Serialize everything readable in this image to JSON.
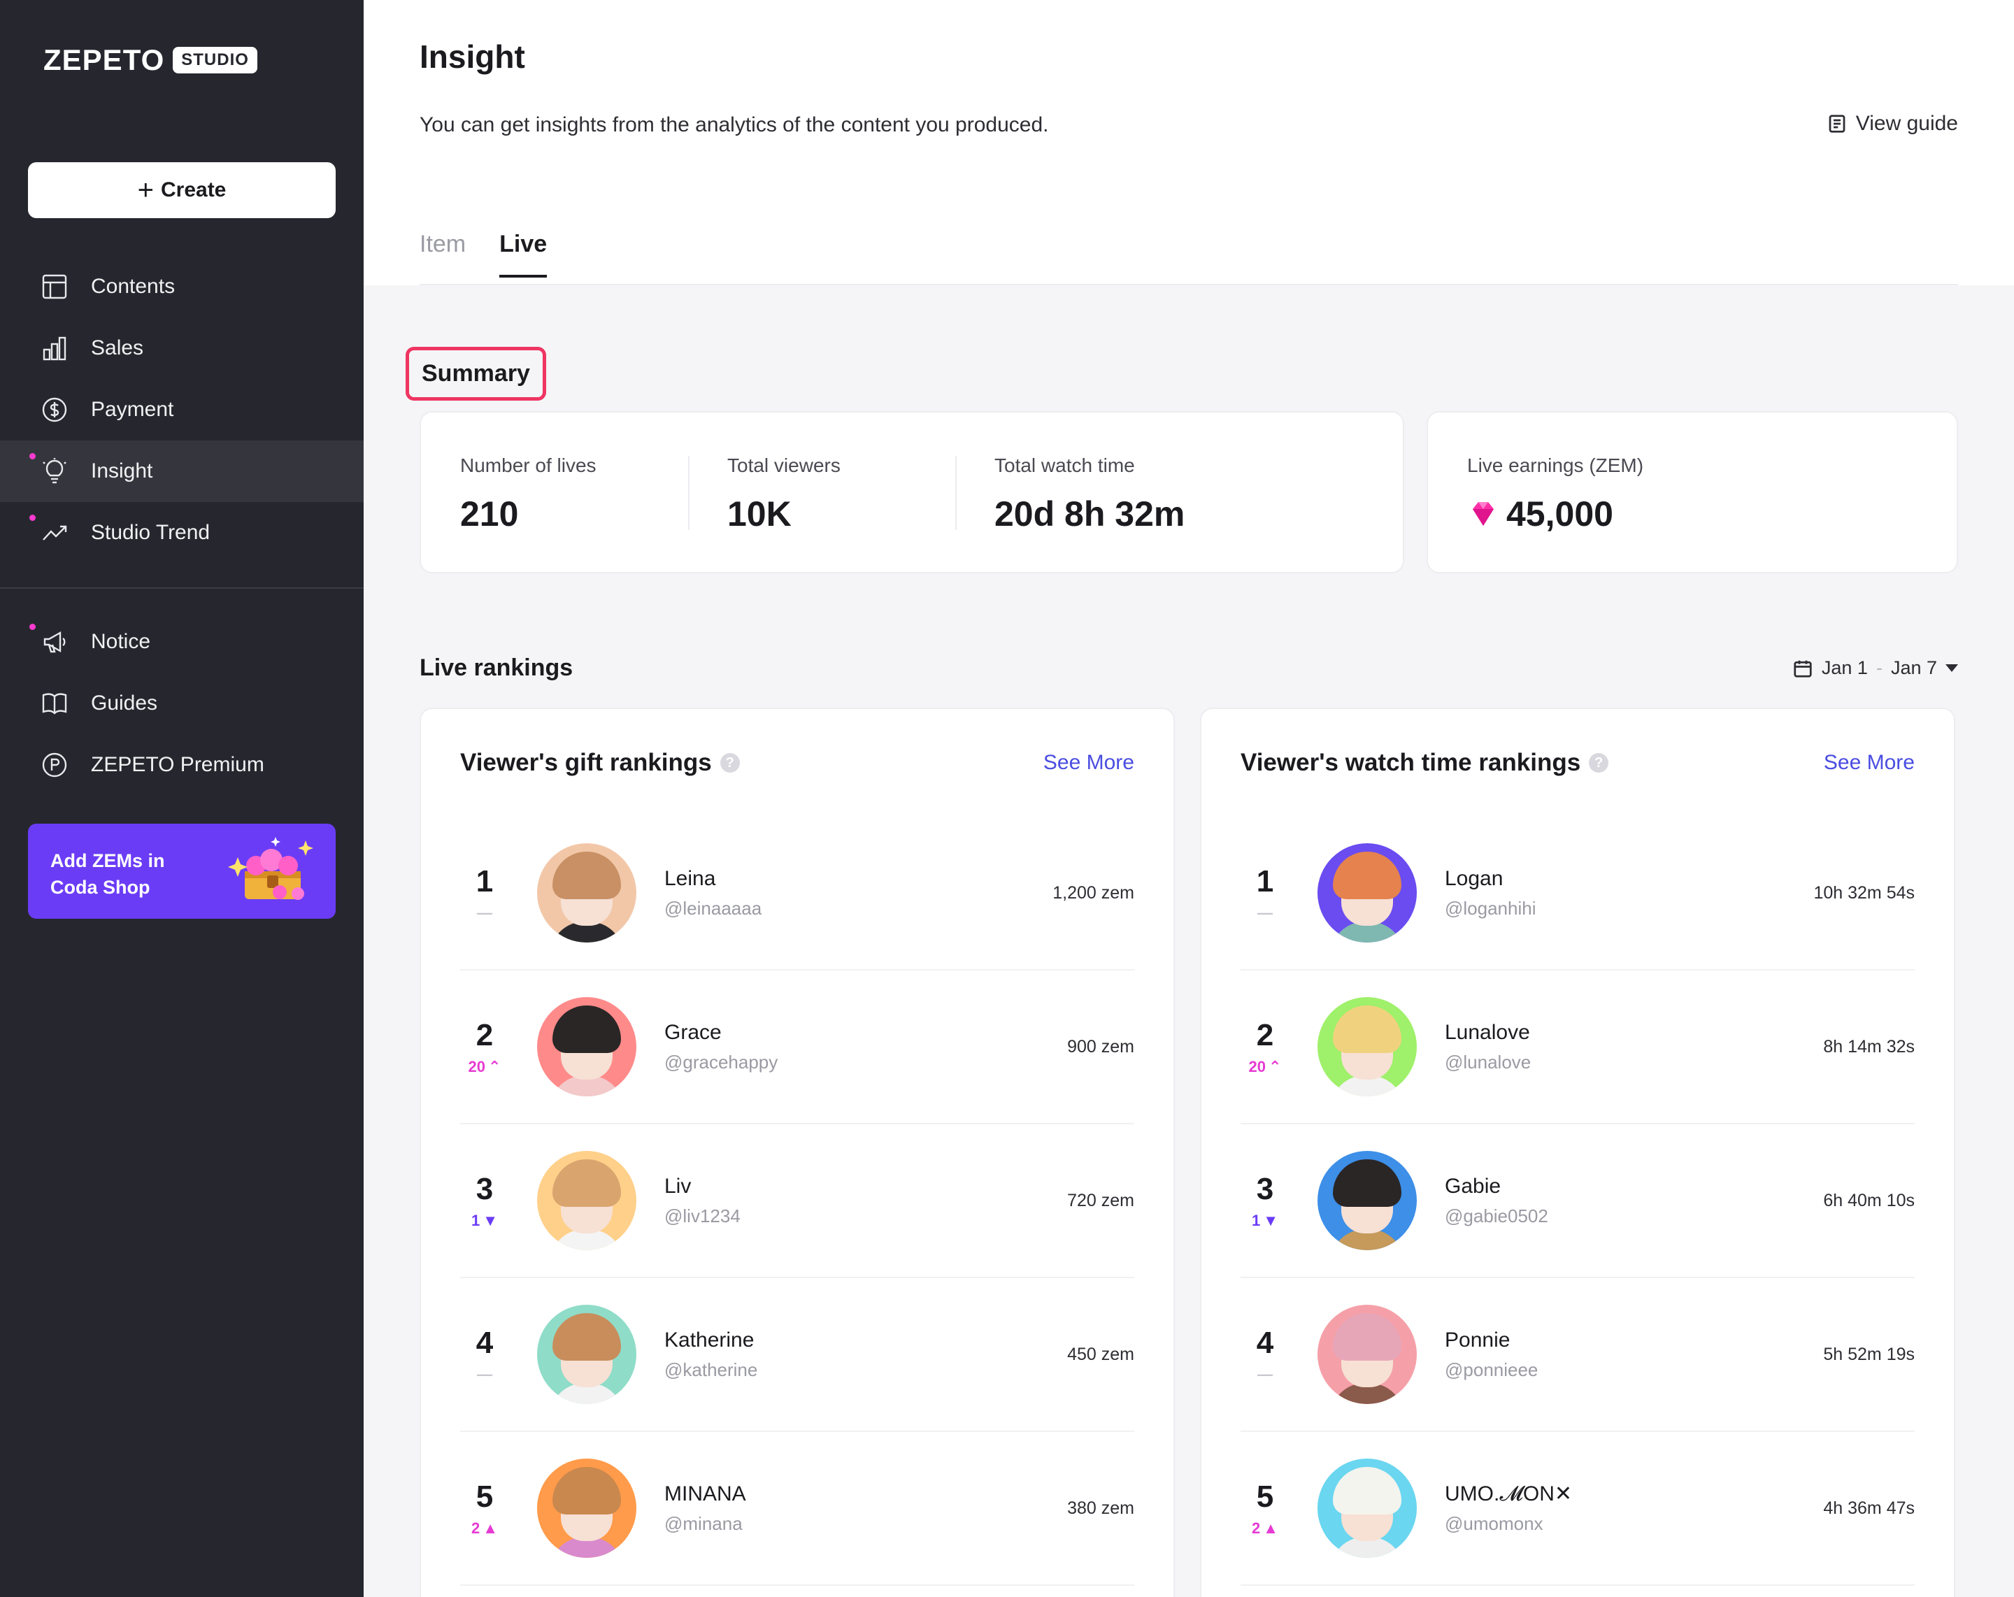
{
  "sidebar": {
    "logo": "ZEPETO",
    "logo_badge": "STUDIO",
    "create_label": "Create",
    "nav": [
      {
        "label": "Contents",
        "icon": "layout-icon",
        "dot": false,
        "active": false
      },
      {
        "label": "Sales",
        "icon": "bar-chart-icon",
        "dot": false,
        "active": false
      },
      {
        "label": "Payment",
        "icon": "dollar-coin-icon",
        "dot": false,
        "active": false
      },
      {
        "label": "Insight",
        "icon": "lightbulb-icon",
        "dot": true,
        "active": true
      },
      {
        "label": "Studio Trend",
        "icon": "trend-up-icon",
        "dot": true,
        "active": false
      }
    ],
    "nav2": [
      {
        "label": "Notice",
        "icon": "megaphone-icon",
        "dot": true
      },
      {
        "label": "Guides",
        "icon": "book-icon",
        "dot": false
      },
      {
        "label": "ZEPETO Premium",
        "icon": "premium-p-icon",
        "dot": false
      }
    ],
    "promo": {
      "line1": "Add ZEMs in",
      "line2": "Coda Shop"
    }
  },
  "header": {
    "title": "Insight",
    "description": "You can get insights from the analytics of the content you produced.",
    "view_guide": "View guide",
    "tabs": [
      {
        "label": "Item",
        "active": false
      },
      {
        "label": "Live",
        "active": true
      }
    ]
  },
  "summary": {
    "title": "Summary",
    "stats": [
      {
        "label": "Number of lives",
        "value": "210"
      },
      {
        "label": "Total viewers",
        "value": "10K"
      },
      {
        "label": "Total watch time",
        "value": "20d 8h 32m"
      }
    ],
    "earnings": {
      "label": "Live earnings (ZEM)",
      "value": "45,000"
    }
  },
  "rankings": {
    "title": "Live rankings",
    "date_start": "Jan 1",
    "date_sep": "-",
    "date_end": "Jan 7",
    "gift": {
      "title": "Viewer's gift rankings",
      "see_more": "See More",
      "rows": [
        {
          "rank": "1",
          "change": "—",
          "dir": "none",
          "name": "Leina",
          "handle": "@leinaaaaa",
          "value": "1,200 zem",
          "bg": "#f2c7a8",
          "hair": "#c89064",
          "body": "#2a2a2e"
        },
        {
          "rank": "2",
          "change": "20",
          "dir": "up",
          "name": "Grace",
          "handle": "@gracehappy",
          "value": "900 zem",
          "bg": "#ff8a8a",
          "hair": "#2a2626",
          "body": "#f3c9c9"
        },
        {
          "rank": "3",
          "change": "1",
          "dir": "down",
          "name": "Liv",
          "handle": "@liv1234",
          "value": "720 zem",
          "bg": "#ffd08a",
          "hair": "#d9a46e",
          "body": "#f4f4f4"
        },
        {
          "rank": "4",
          "change": "—",
          "dir": "none",
          "name": "Katherine",
          "handle": "@katherine",
          "value": "450 zem",
          "bg": "#8fdcc8",
          "hair": "#c98d5c",
          "body": "#f2f2f2"
        },
        {
          "rank": "5",
          "change": "2",
          "dir": "up",
          "name": "MINANA",
          "handle": "@minana",
          "value": "380 zem",
          "bg": "#ff9b4a",
          "hair": "#c9884e",
          "body": "#d98acd"
        }
      ]
    },
    "watch": {
      "title": "Viewer's watch time rankings",
      "see_more": "See More",
      "rows": [
        {
          "rank": "1",
          "change": "—",
          "dir": "none",
          "name": "Logan",
          "handle": "@loganhihi",
          "value": "10h 32m 54s",
          "bg": "#6a4cf0",
          "hair": "#e5824e",
          "body": "#7fb8b0"
        },
        {
          "rank": "2",
          "change": "20",
          "dir": "up",
          "name": "Lunalove",
          "handle": "@lunalove",
          "value": "8h 14m 32s",
          "bg": "#9ff06a",
          "hair": "#f0d27e",
          "body": "#f2f2f2"
        },
        {
          "rank": "3",
          "change": "1",
          "dir": "down",
          "name": "Gabie",
          "handle": "@gabie0502",
          "value": "6h 40m 10s",
          "bg": "#3d8fe8",
          "hair": "#2a2626",
          "body": "#c59a5a"
        },
        {
          "rank": "4",
          "change": "—",
          "dir": "none",
          "name": "Ponnie",
          "handle": "@ponnieee",
          "value": "5h 52m 19s",
          "bg": "#f5a0a8",
          "hair": "#e6a6b8",
          "body": "#8a5a4a"
        },
        {
          "rank": "5",
          "change": "2",
          "dir": "up",
          "name": "UMO.𝓜ON✕",
          "handle": "@umomonx",
          "value": "4h 36m 47s",
          "bg": "#6ad6f0",
          "hair": "#f4f4ee",
          "body": "#eeeeee"
        }
      ]
    }
  }
}
